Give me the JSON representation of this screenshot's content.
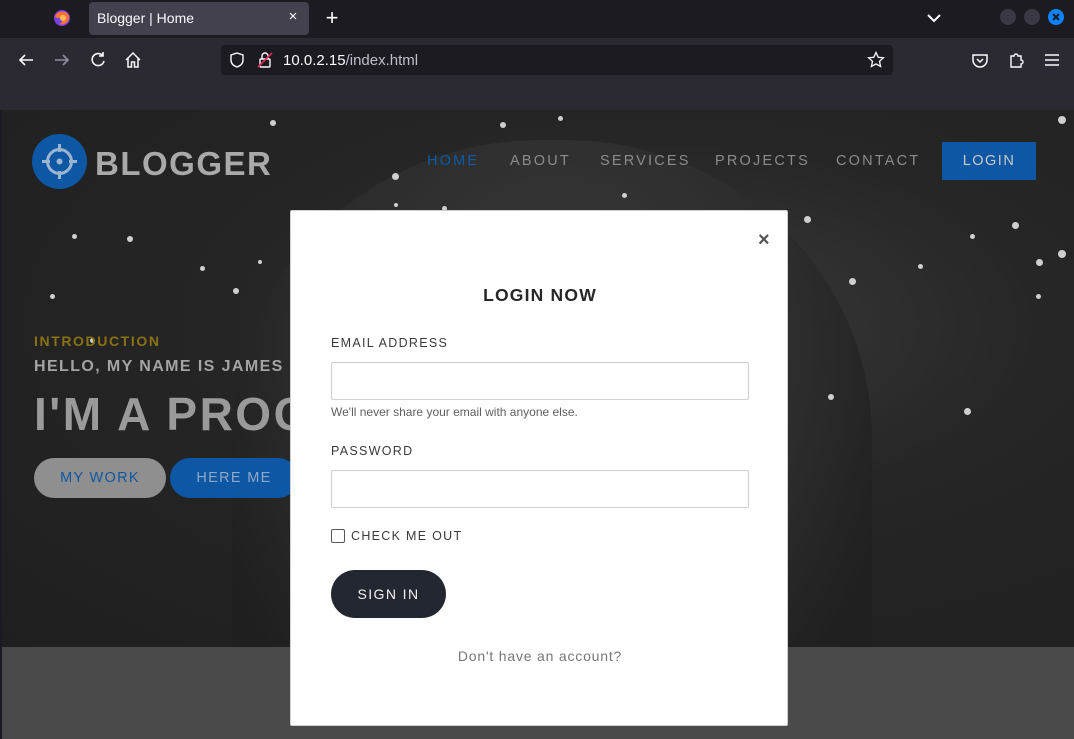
{
  "browser": {
    "tab_title": "Blogger | Home",
    "tab_close": "×",
    "new_tab": "+",
    "url_host": "10.0.2.15",
    "url_path": "/index.html",
    "accent": "#0a84ff"
  },
  "site": {
    "logo_text": "BLOGGER",
    "menu": [
      {
        "label": "HOME",
        "active": true
      },
      {
        "label": "ABOUT",
        "active": false
      },
      {
        "label": "SERVICES",
        "active": false
      },
      {
        "label": "PROJECTS",
        "active": false
      },
      {
        "label": "CONTACT",
        "active": false
      }
    ],
    "login_label": "LOGIN",
    "brand_color": "#0d57a4"
  },
  "hero": {
    "intro": "INTRODUCTION",
    "hello": "HELLO, MY NAME IS JAMES",
    "headline": "I'M A PROG",
    "btn_work": "MY WORK",
    "btn_here": "HERE ME"
  },
  "modal": {
    "close": "×",
    "title": "LOGIN NOW",
    "email_label": "EMAIL ADDRESS",
    "email_value": "",
    "email_help": "We'll never share your email with anyone else.",
    "password_label": "PASSWORD",
    "password_value": "",
    "check_label": "CHECK ME OUT",
    "check_checked": false,
    "signin_label": "SIGN IN",
    "account_text": "Don't have an account?"
  }
}
